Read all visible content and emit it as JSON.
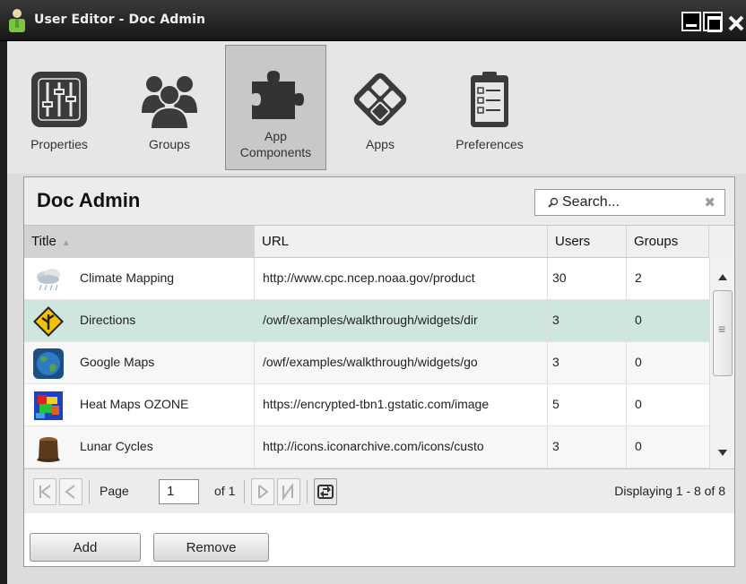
{
  "window": {
    "title": "User Editor - Doc Admin",
    "controls": [
      "minimize",
      "maximize",
      "close"
    ]
  },
  "toolbar": {
    "items": [
      {
        "label": "Properties",
        "icon": "sliders-icon"
      },
      {
        "label": "Groups",
        "icon": "people-icon"
      },
      {
        "label": "App\nComponents",
        "icon": "puzzle-icon",
        "active": true
      },
      {
        "label": "Apps",
        "icon": "diamond-grid-icon"
      },
      {
        "label": "Preferences",
        "icon": "clipboard-checklist-icon"
      }
    ]
  },
  "panel": {
    "title": "Doc Admin",
    "search": {
      "placeholder": "Search..."
    }
  },
  "grid": {
    "columns": [
      "Title",
      "URL",
      "Users",
      "Groups"
    ],
    "sorted_column": "Title",
    "rows": [
      {
        "title": "Climate Mapping",
        "url": "http://www.cpc.ncep.noaa.gov/product",
        "users": "30",
        "groups": "2",
        "icon": "cloud-rain-icon"
      },
      {
        "title": "Directions",
        "url": "/owf/examples/walkthrough/widgets/dir",
        "users": "3",
        "groups": "0",
        "icon": "road-sign-icon",
        "selected": true
      },
      {
        "title": "Google Maps",
        "url": "/owf/examples/walkthrough/widgets/go",
        "users": "3",
        "groups": "0",
        "icon": "globe-icon"
      },
      {
        "title": "Heat Maps OZONE",
        "url": "https://encrypted-tbn1.gstatic.com/image",
        "users": "5",
        "groups": "0",
        "icon": "heatmap-icon"
      },
      {
        "title": "Lunar Cycles",
        "url": "http://icons.iconarchive.com/icons/custo",
        "users": "3",
        "groups": "0",
        "icon": "stump-icon"
      }
    ]
  },
  "pager": {
    "page_label": "Page",
    "page_value": "1",
    "of_label": "of 1",
    "display_text": "Displaying 1 - 8 of 8"
  },
  "actions": {
    "add_label": "Add",
    "remove_label": "Remove"
  },
  "colors": {
    "selected_row": "#cfe5df",
    "title_bar": "#1e1e1e"
  }
}
